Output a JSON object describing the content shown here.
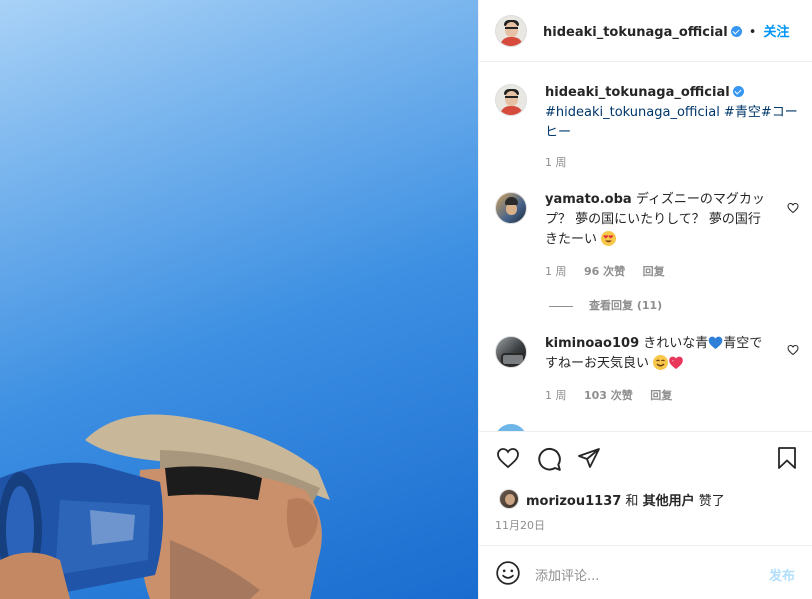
{
  "post": {
    "username": "hideaki_tokunaga_official",
    "follow_label": "关注",
    "separator": "•",
    "caption_tags": "#hideaki_tokunaga_official #青空#コーヒー",
    "caption_time": "1 周"
  },
  "comments": [
    {
      "username": "yamato.oba",
      "text": "ディズニーのマグカップ？ 夢の国にいたりして？ 夢の国行きたーい",
      "time": "1 周",
      "likes": "96 次赞",
      "reply_label": "回复",
      "view_replies": "查看回复 (11)"
    },
    {
      "username": "kiminoao109",
      "text_part1": "きれいな青",
      "text_part2": "青空ですねーお天気良い",
      "time": "1 周",
      "likes": "103 次赞",
      "reply_label": "回复"
    }
  ],
  "likes_summary": {
    "user": "morizou1137",
    "connector": "和",
    "others": "其他用户",
    "suffix": "赞了"
  },
  "date": "11月20日",
  "add_comment": {
    "placeholder": "添加评论...",
    "post_label": "发布"
  },
  "colors": {
    "accent": "#0095f6",
    "verified": "#3797f0",
    "sky_top": "#a9d2f7",
    "sky_bottom": "#1a6ccf"
  }
}
